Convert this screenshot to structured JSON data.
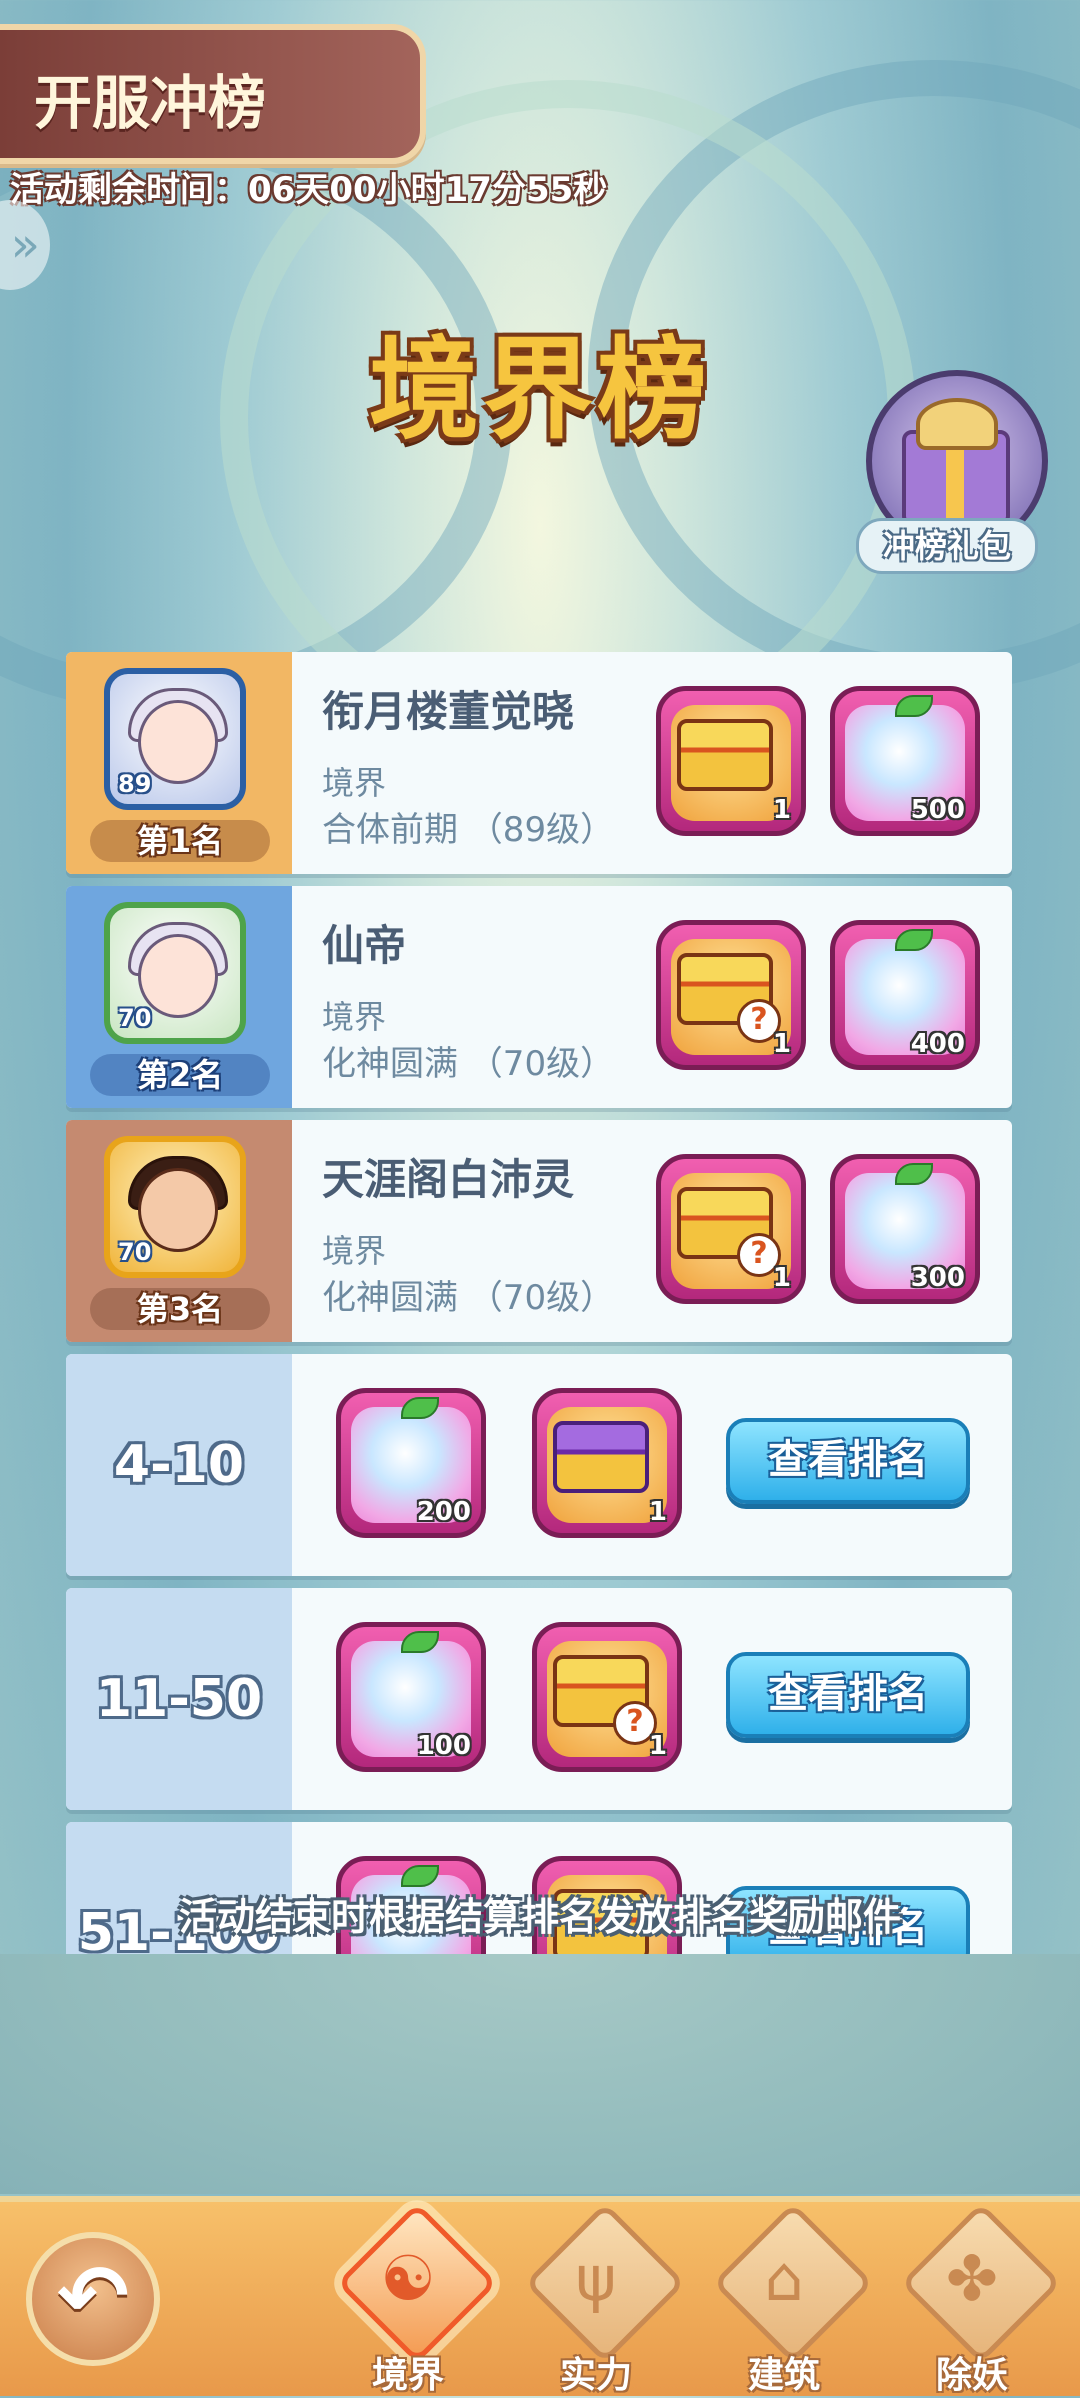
{
  "header": {
    "title": "开服冲榜",
    "timer_label": "活动剩余时间：06天00小时17分55秒"
  },
  "heading": "境界榜",
  "gift": {
    "label": "冲榜礼包",
    "icon": "gift-box-icon"
  },
  "top_ranks": [
    {
      "place": "第1名",
      "avatar_level": "89",
      "name": "衔月楼董觉晓",
      "realm_label": "境界",
      "realm_value": "合体前期 （89级）",
      "rewards": [
        {
          "type": "treasure-chest-icon",
          "qty": "1"
        },
        {
          "type": "spirit-fruit-icon",
          "qty": "500"
        }
      ]
    },
    {
      "place": "第2名",
      "avatar_level": "70",
      "name": "仙帝",
      "realm_label": "境界",
      "realm_value": "化神圆满 （70级）",
      "rewards": [
        {
          "type": "mystery-chest-icon",
          "qty": "1"
        },
        {
          "type": "spirit-fruit-icon",
          "qty": "400"
        }
      ]
    },
    {
      "place": "第3名",
      "avatar_level": "70",
      "name": "天涯阁白沛灵",
      "realm_label": "境界",
      "realm_value": "化神圆满 （70级）",
      "rewards": [
        {
          "type": "mystery-chest-icon",
          "qty": "1"
        },
        {
          "type": "spirit-fruit-icon",
          "qty": "300"
        }
      ]
    }
  ],
  "tiers": [
    {
      "range": "4-10",
      "rewards": [
        {
          "type": "spirit-fruit-icon",
          "qty": "200"
        },
        {
          "type": "purple-chest-icon",
          "qty": "1"
        }
      ],
      "button": "查看排名"
    },
    {
      "range": "11-50",
      "rewards": [
        {
          "type": "spirit-fruit-icon",
          "qty": "100"
        },
        {
          "type": "mystery-chest-icon",
          "qty": "1"
        }
      ],
      "button": "查看排名"
    },
    {
      "range": "51-100",
      "rewards": [
        {
          "type": "spirit-fruit-icon",
          "qty": ""
        },
        {
          "type": "treasure-chest-icon",
          "qty": ""
        }
      ],
      "button": "查看排名"
    }
  ],
  "notice": "活动结束时根据结算排名发放排名奖励邮件",
  "nav": {
    "back_icon": "back-arrow-icon",
    "tabs": [
      {
        "label": "境界",
        "icon": "yin-yang-icon",
        "glyph": "☯",
        "active": true
      },
      {
        "label": "实力",
        "icon": "trident-icon",
        "glyph": "ψ",
        "active": false
      },
      {
        "label": "建筑",
        "icon": "pagoda-icon",
        "glyph": "⌂",
        "active": false
      },
      {
        "label": "除妖",
        "icon": "paw-icon",
        "glyph": "✤",
        "active": false
      }
    ]
  },
  "colors": {
    "accent_gold": "#f6c53f",
    "first_place": "#f2b764",
    "second_place": "#6fa6df",
    "third_place": "#c58a70",
    "button_blue": "#2fb0ea"
  }
}
